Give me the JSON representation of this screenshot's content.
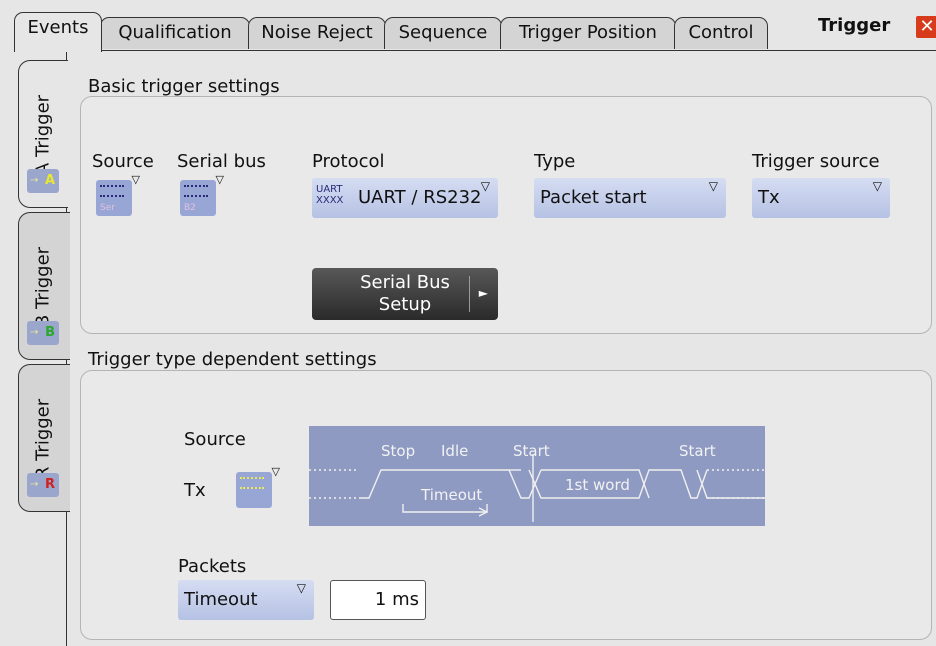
{
  "tabs": [
    "Events",
    "Qualification",
    "Noise Reject",
    "Sequence",
    "Trigger Position",
    "Control"
  ],
  "dialog_title": "Trigger",
  "close_icon": "close-icon",
  "side_tabs": [
    {
      "label": "A Trigger",
      "icon_letter": "A"
    },
    {
      "label": "B Trigger",
      "icon_letter": "B"
    },
    {
      "label": "R Trigger",
      "icon_letter": "R"
    }
  ],
  "basic": {
    "title": "Basic trigger settings",
    "source_label": "Source",
    "serial_bus_label": "Serial bus",
    "source_icon_text": "Ser",
    "serial_bus_icon_text": "B2",
    "protocol_label": "Protocol",
    "protocol_icon_text": "UART",
    "protocol_value": "UART / RS232",
    "type_label": "Type",
    "type_value": "Packet start",
    "trigger_source_label": "Trigger source",
    "trigger_source_value": "Tx",
    "setup_button_line1": "Serial Bus",
    "setup_button_line2": "Setup"
  },
  "dependent": {
    "title": "Trigger type dependent settings",
    "source_label": "Source",
    "source_value": "Tx",
    "diagram_labels": {
      "stop": "Stop",
      "idle": "Idle",
      "start1": "Start",
      "start2": "Start",
      "timeout": "Timeout",
      "first_word": "1st word"
    },
    "packets_label": "Packets",
    "packets_value": "Timeout",
    "timeout_value": "1 ms"
  },
  "colors": {
    "dropdown": "#b6c2e4",
    "diagram_bg": "#8e9ac2",
    "close": "#d83a1c"
  }
}
